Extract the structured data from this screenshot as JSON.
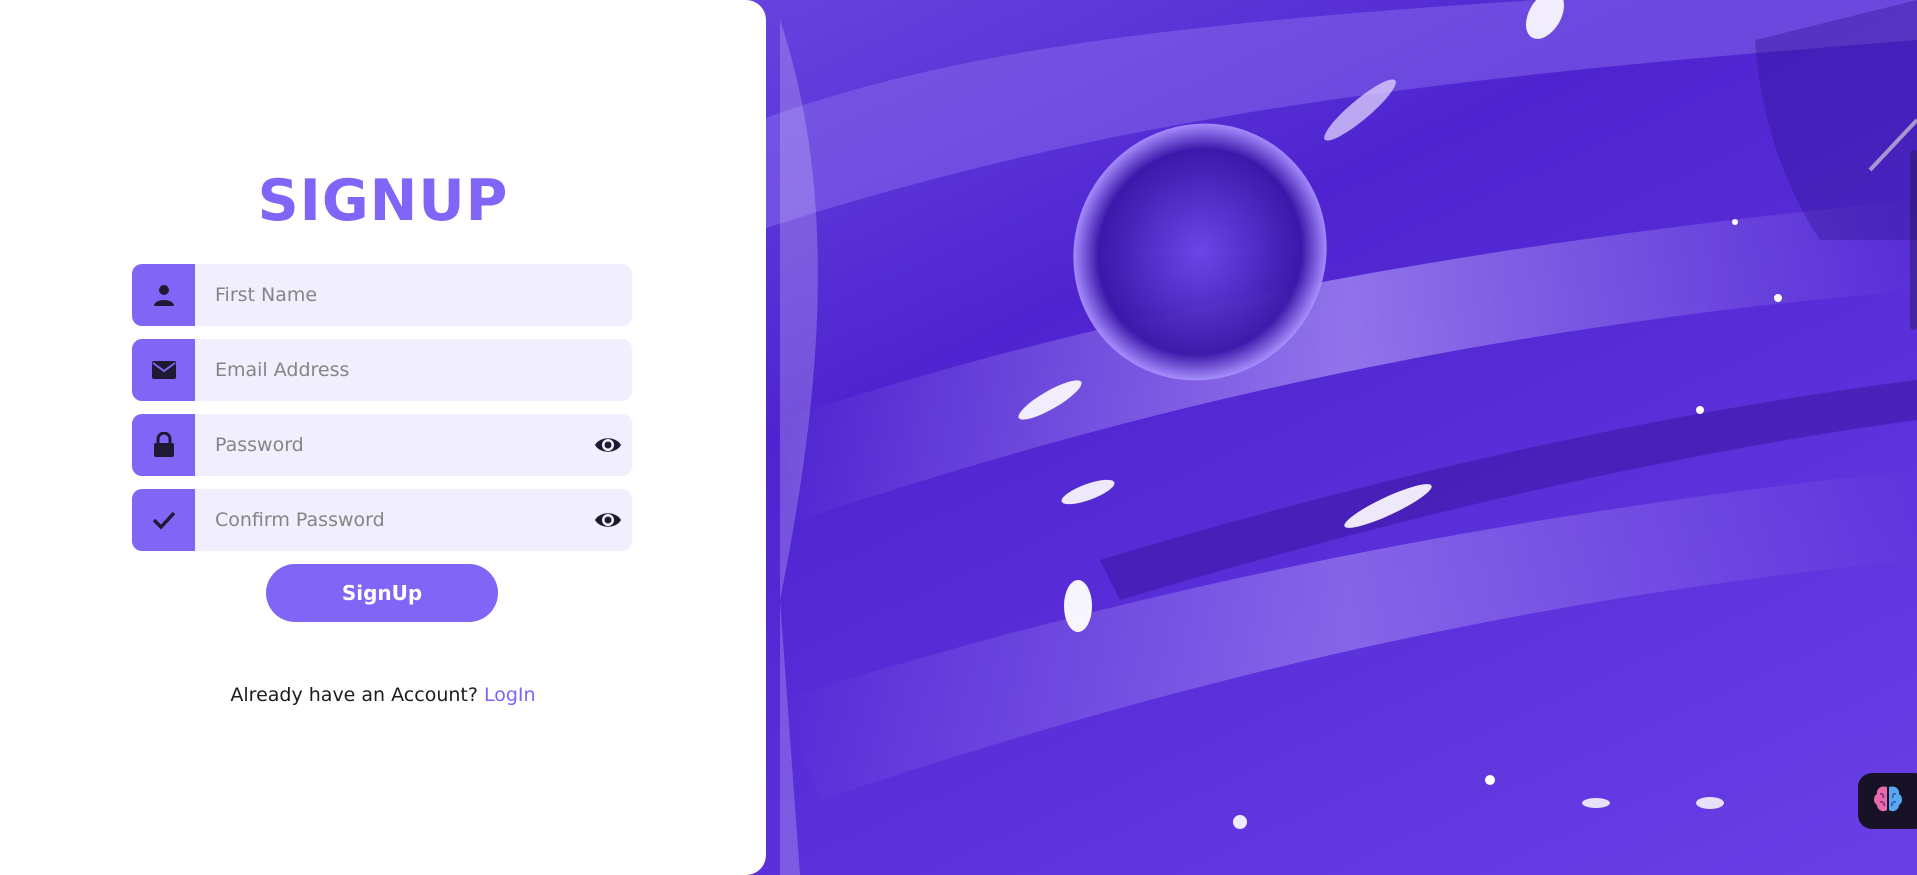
{
  "form": {
    "title": "SIGNUP",
    "fields": [
      {
        "icon": "user-icon",
        "placeholder": "First Name",
        "value": "",
        "has_visibility_toggle": false
      },
      {
        "icon": "envelope-icon",
        "placeholder": "Email Address",
        "value": "",
        "has_visibility_toggle": false
      },
      {
        "icon": "lock-icon",
        "placeholder": "Password",
        "value": "",
        "has_visibility_toggle": true
      },
      {
        "icon": "check-icon",
        "placeholder": "Confirm Password",
        "value": "",
        "has_visibility_toggle": true
      }
    ],
    "submit_label": "SignUp",
    "footer_text": "Already have an Account?",
    "footer_link_label": "LogIn"
  },
  "colors": {
    "accent": "#8065f6",
    "field_bg": "#f1eefe",
    "panel_bg": "#ffffff",
    "hero_purple": "#5b2fd6"
  },
  "floating_widget": {
    "icon": "brain-icon"
  }
}
